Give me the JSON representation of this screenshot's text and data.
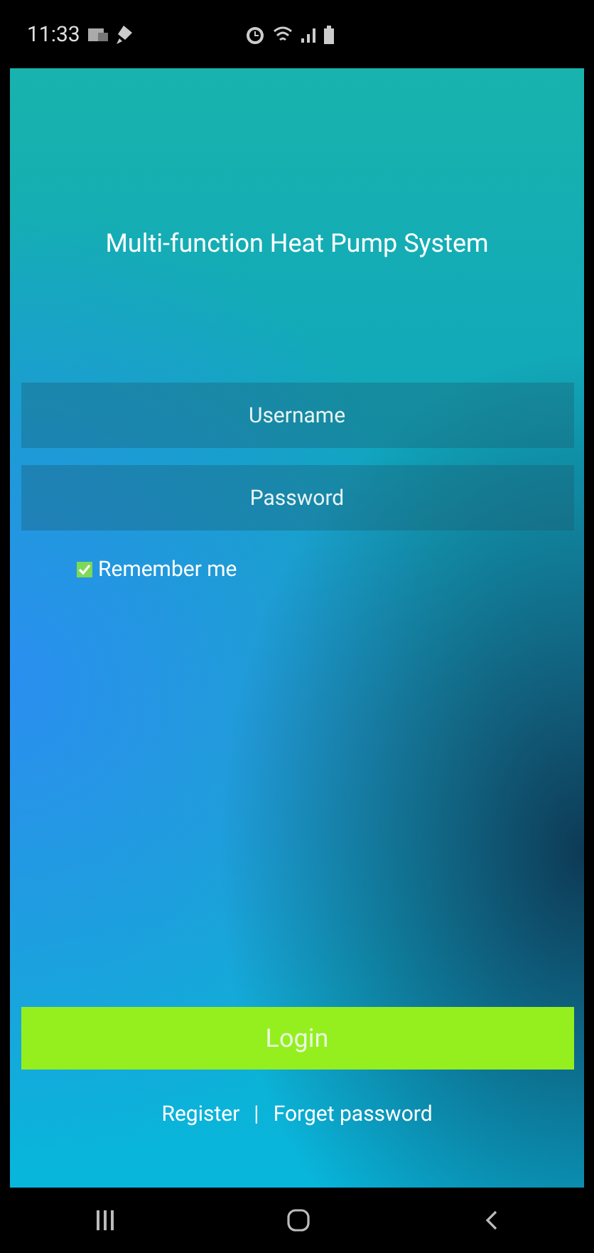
{
  "status_bar": {
    "time": "11:33"
  },
  "title": "Multi-function Heat Pump System",
  "username": {
    "placeholder": "Username"
  },
  "password": {
    "placeholder": "Password"
  },
  "remember": {
    "label": "Remember me",
    "checked": true
  },
  "login_button": "Login",
  "links": {
    "register": "Register",
    "separator": "|",
    "forgot": "Forget password"
  }
}
